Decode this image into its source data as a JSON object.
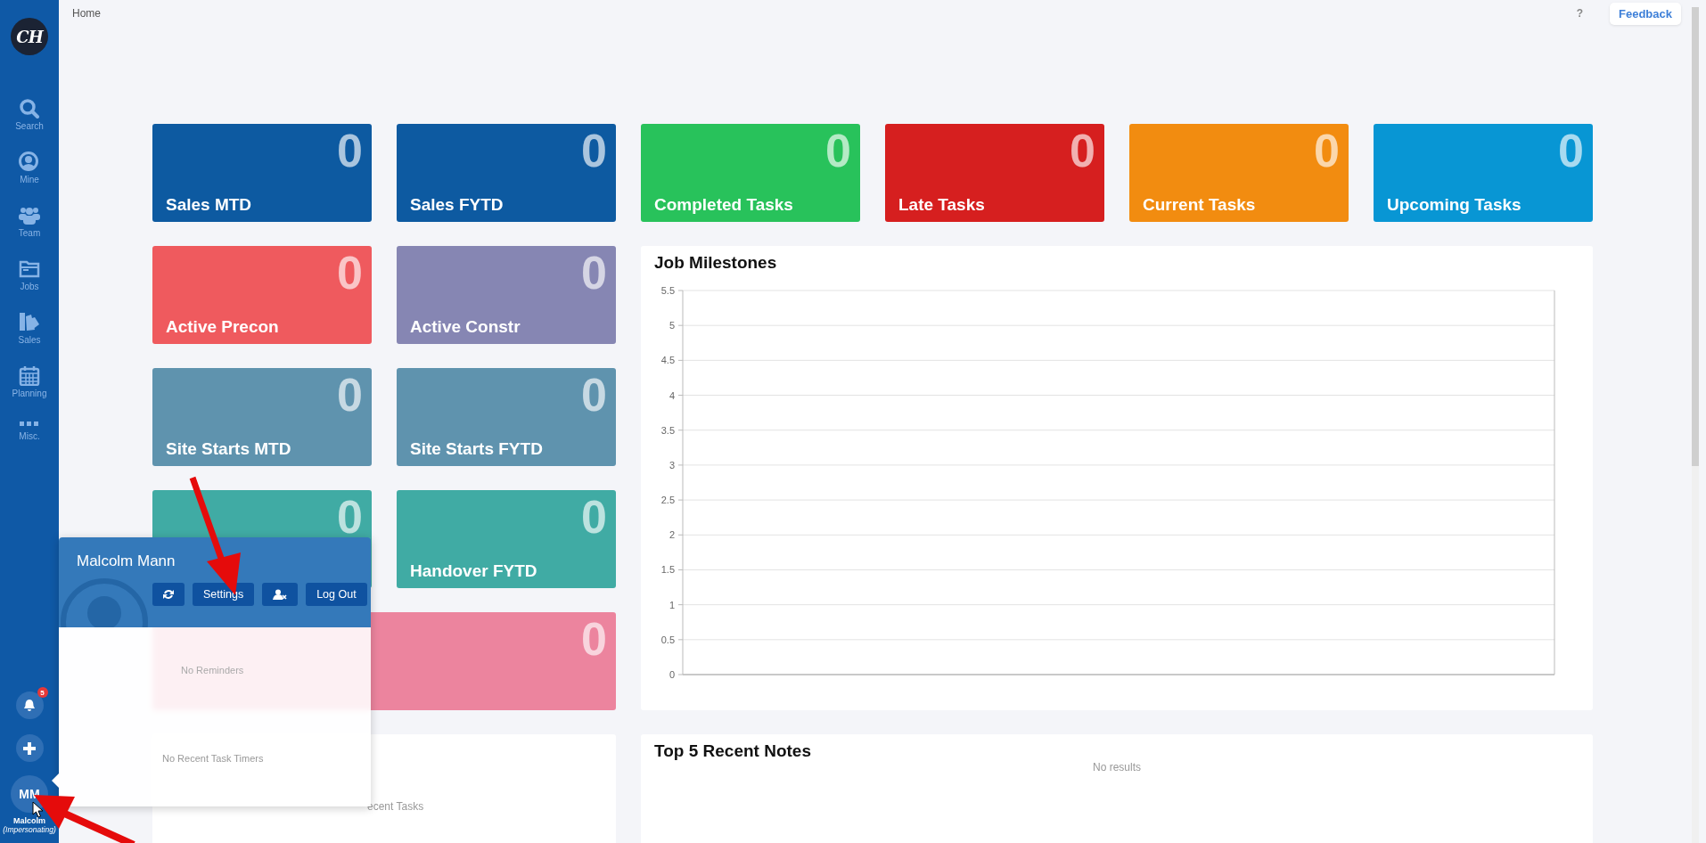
{
  "sidebar": {
    "logo": "CH",
    "items": [
      {
        "kind": "search",
        "label": "Search"
      },
      {
        "kind": "mine",
        "label": "Mine"
      },
      {
        "kind": "team",
        "label": "Team"
      },
      {
        "kind": "jobs",
        "label": "Jobs"
      },
      {
        "kind": "sales",
        "label": "Sales"
      },
      {
        "kind": "planning",
        "label": "Planning"
      },
      {
        "kind": "misc",
        "label": "Misc."
      }
    ],
    "notifications_badge": "5",
    "avatar_initials": "MM",
    "user_name": "Malcolm",
    "user_note": "(Impersonating)"
  },
  "breadcrumb": "Home",
  "help": "?",
  "feedback": "Feedback",
  "tiles": [
    {
      "kind": "tile",
      "label": "Sales MTD",
      "value": "0",
      "color": "#0d5aa1"
    },
    {
      "kind": "tile",
      "label": "Sales FYTD",
      "value": "0",
      "color": "#0d5aa1"
    },
    {
      "kind": "tile",
      "label": "Completed Tasks",
      "value": "0",
      "color": "#28c25b"
    },
    {
      "kind": "tile",
      "label": "Late Tasks",
      "value": "0",
      "color": "#d61f1f"
    },
    {
      "kind": "tile",
      "label": "Current Tasks",
      "value": "0",
      "color": "#f28c10"
    },
    {
      "kind": "tile",
      "label": "Upcoming Tasks",
      "value": "0",
      "color": "#0896d4"
    },
    {
      "kind": "tile",
      "label": "Active Precon",
      "value": "0",
      "color": "#ef5a5e"
    },
    {
      "kind": "tile",
      "label": "Active Constr",
      "value": "0",
      "color": "#8686b3"
    },
    {
      "kind": "tile",
      "label": "Site Starts MTD",
      "value": "0",
      "color": "#5f93ae"
    },
    {
      "kind": "tile",
      "label": "Site Starts FYTD",
      "value": "0",
      "color": "#5f93ae"
    },
    {
      "kind": "tile",
      "value": "0",
      "color": "#40aba4"
    },
    {
      "kind": "tile",
      "label": "Handover FYTD",
      "value": "0",
      "color": "#40aba4"
    },
    {
      "kind": "wide",
      "value": "0",
      "color": "#ec849e"
    }
  ],
  "milestones": {
    "title": "Job Milestones",
    "kind": "empty_plot",
    "y_axis_labels": [
      "5.5",
      "5",
      "4.5",
      "4",
      "3.5",
      "3",
      "2.5",
      "2",
      "1.5",
      "1",
      "0.5",
      "0"
    ]
  },
  "recent_tasks": {
    "empty_text": "ecent Tasks"
  },
  "recent_notes": {
    "title": "Top 5 Recent Notes",
    "empty_text": "No results"
  },
  "user_popup": {
    "name": "Malcolm Mann",
    "buttons": [
      {
        "kind": "refresh"
      },
      {
        "kind": "text",
        "label": "Settings"
      },
      {
        "kind": "unimpersonate"
      },
      {
        "kind": "text",
        "label": "Log Out"
      }
    ],
    "reminders_text": "No Reminders",
    "timers_text": "No Recent Task Timers"
  }
}
